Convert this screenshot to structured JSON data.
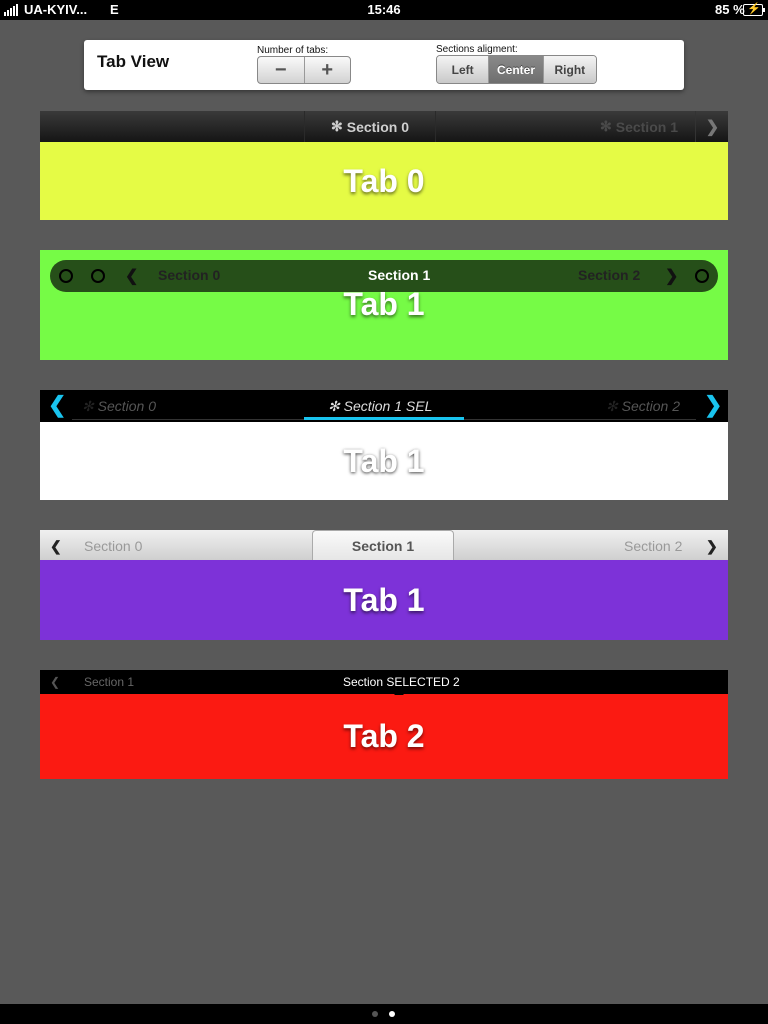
{
  "status": {
    "carrier": "UA-KYIV...",
    "network": "E",
    "time": "15:46",
    "battery": "85 %"
  },
  "panel": {
    "title": "Tab View",
    "tabs_label": "Number of tabs:",
    "minus": "−",
    "plus": "+",
    "align_label": "Sections aligment:",
    "align_options": [
      "Left",
      "Center",
      "Right"
    ],
    "align_selected": "Center"
  },
  "views": [
    {
      "bar": {
        "selected": "Section 0",
        "next": "Section 1",
        "next_arrow": "❯",
        "icon": "✻"
      },
      "tab": "Tab 0",
      "color": "#e5fb45"
    },
    {
      "bar": {
        "prev": "Section 0",
        "selected": "Section 1",
        "next": "Section 2",
        "prev_arrow": "❮",
        "next_arrow": "❯"
      },
      "tab": "Tab 1",
      "color": "#76fb46"
    },
    {
      "bar": {
        "prev": "Section 0",
        "selected": "Section 1 SEL",
        "next": "Section 2",
        "prev_arrow": "❮",
        "next_arrow": "❯",
        "icon": "✻"
      },
      "tab": "Tab 1",
      "color": "#ffffff"
    },
    {
      "bar": {
        "prev": "Section 0",
        "selected": "Section 1",
        "next": "Section 2",
        "prev_arrow": "❮",
        "next_arrow": "❯"
      },
      "tab": "Tab 1",
      "color": "#7d32d8"
    },
    {
      "bar": {
        "prev": "Section 1",
        "selected": "Section SELECTED 2",
        "prev_arrow": "❮"
      },
      "tab": "Tab 2",
      "color": "#fb1a12"
    }
  ],
  "page_dots": {
    "count": 2,
    "active": 1
  }
}
